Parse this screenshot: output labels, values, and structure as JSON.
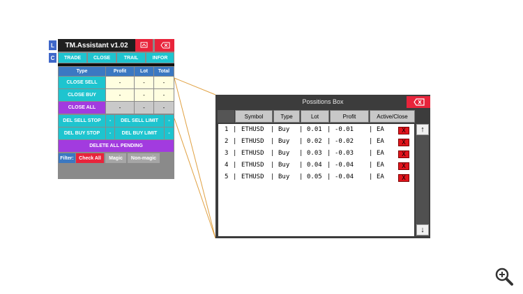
{
  "side_buttons": [
    "L",
    "C"
  ],
  "assistant": {
    "title": "TM.Assistant v1.02",
    "minimize_icon": "minimize-icon",
    "close_icon": "close-backspace-icon",
    "menu": [
      "TRADE",
      "CLOSE",
      "TRAIL",
      "INFOR"
    ],
    "table_headers": [
      "Type",
      "Profit",
      "Lot",
      "Total"
    ],
    "rows": [
      {
        "label": "CLOSE SELL",
        "profit": "-",
        "lot": "-",
        "total": "-"
      },
      {
        "label": "CLOSE BUY",
        "profit": "-",
        "lot": "-",
        "total": "-"
      },
      {
        "label": "CLOSE ALL",
        "profit": "-",
        "lot": "-",
        "total": "-"
      }
    ],
    "pending": [
      {
        "left": "DEL SELL STOP",
        "left_val": "-",
        "right": "DEL SELL LIMIT",
        "right_val": "-"
      },
      {
        "left": "DEL BUY STOP",
        "left_val": "-",
        "right": "DEL BUY LIMIT",
        "right_val": "-"
      }
    ],
    "delete_all": "DELETE ALL PENDING",
    "filter": {
      "label": "Filter:",
      "check_all": "Check All",
      "magic": "Magic",
      "non_magic": "Non-magic"
    }
  },
  "positions_box": {
    "title": "Possitions Box",
    "close_icon": "close-backspace-icon",
    "columns": [
      "Symbol",
      "Type",
      "Lot",
      "Profit",
      "Active/Close"
    ],
    "rows": [
      {
        "n": "1",
        "symbol": "ETHUSD",
        "type": "Buy",
        "lot": "0.01",
        "profit": "-0.01",
        "active": "EA",
        "x": "X"
      },
      {
        "n": "2",
        "symbol": "ETHUSD",
        "type": "Buy",
        "lot": "0.02",
        "profit": "-0.02",
        "active": "EA",
        "x": "X"
      },
      {
        "n": "3",
        "symbol": "ETHUSD",
        "type": "Buy",
        "lot": "0.03",
        "profit": "-0.03",
        "active": "EA",
        "x": "X"
      },
      {
        "n": "4",
        "symbol": "ETHUSD",
        "type": "Buy",
        "lot": "0.04",
        "profit": "-0.04",
        "active": "EA",
        "x": "X"
      },
      {
        "n": "5",
        "symbol": "ETHUSD",
        "type": "Buy",
        "lot": "0.05",
        "profit": "-0.04",
        "active": "EA",
        "x": "X"
      }
    ],
    "scroll_up": "↑",
    "scroll_down": "↓"
  },
  "zoom_icon": "zoom-in-icon",
  "colors": {
    "cyan": "#1ec4cf",
    "purple": "#a23bdf",
    "red": "#e8243b",
    "header_blue": "#3b78c2",
    "connector": "#e0a040"
  }
}
